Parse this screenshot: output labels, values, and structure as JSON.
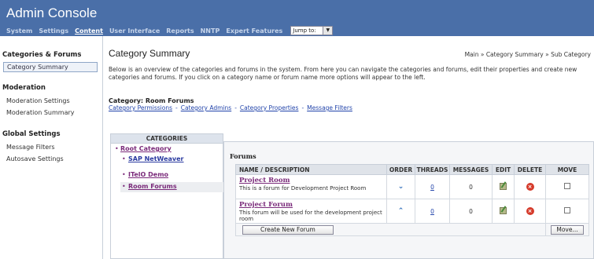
{
  "app_title": "Admin Console",
  "topnav": {
    "items": [
      "System",
      "Settings",
      "Content",
      "User Interface",
      "Reports",
      "NNTP",
      "Expert Features"
    ],
    "active": "Content",
    "jump_label": "Jump to:"
  },
  "sidebar": {
    "sections": [
      {
        "heading": "Categories & Forums",
        "items": [
          "Category Summary"
        ]
      },
      {
        "heading": "Moderation",
        "items": [
          "Moderation Settings",
          "Moderation Summary"
        ]
      },
      {
        "heading": "Global Settings",
        "items": [
          "Message Filters",
          "Autosave Settings"
        ]
      }
    ],
    "selected": "Category Summary"
  },
  "main": {
    "title": "Category Summary",
    "breadcrumb": "Main » Category Summary » Sub Category",
    "description": "Below is an overview of the categories and forums in the system. From here you can navigate the categories and forums, edit their properties and create new categories and forums. If you click on a category name or forum name more options will appear to the left.",
    "category_heading": "Category: Room Forums",
    "category_links": [
      "Category Permissions",
      "Category Admins",
      "Category Properties",
      "Message Filters"
    ]
  },
  "categories": {
    "header": "CATEGORIES",
    "root": "Root Category",
    "children": [
      "SAP NetWeaver",
      "ITelO Demo",
      "Room Forums"
    ],
    "selected": "Room Forums"
  },
  "forums": {
    "label": "Forums",
    "columns": [
      "NAME / DESCRIPTION",
      "ORDER",
      "THREADS",
      "MESSAGES",
      "EDIT",
      "DELETE",
      "MOVE"
    ],
    "rows": [
      {
        "name": "Project Room",
        "description": "This is a forum for Development Project Room",
        "threads": "0",
        "messages": "0",
        "order_icon": "chevron-down"
      },
      {
        "name": "Project Forum",
        "description": "This forum will be used for the development project room",
        "threads": "0",
        "messages": "0",
        "order_icon": "chevron-up"
      }
    ],
    "create_button": "Create New Forum",
    "move_button": "Move..."
  }
}
